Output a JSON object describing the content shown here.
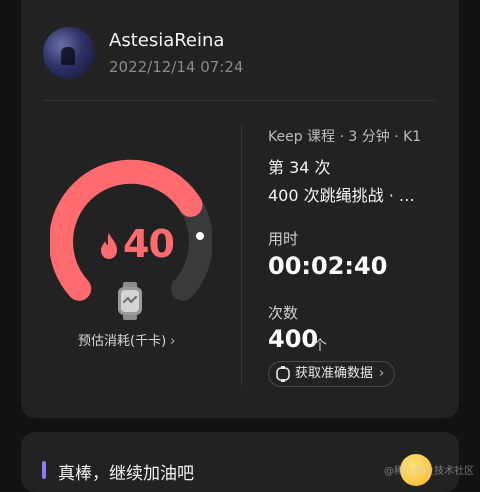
{
  "post": {
    "username": "AstesiaReina",
    "datetime": "2022/12/14 07:24"
  },
  "workout": {
    "calories": "40",
    "calories_label": "预估消耗(千卡)",
    "gauge_progress_fraction": 0.72,
    "course_line": "Keep 课程 · 3 分钟 · K1",
    "session_line": "第 34 次",
    "challenge_line": "400 次跳绳挑战 · …",
    "duration_label": "用时",
    "duration_value": "00:02:40",
    "count_label": "次数",
    "count_value": "400",
    "count_unit": "个",
    "accurate_data_button": "获取准确数据"
  },
  "feedback": {
    "text": "真棒，继续加油吧"
  },
  "watermark": "@稀土掘金技术社区",
  "icons": {
    "chevron": "›"
  },
  "colors": {
    "accent_red": "#ff6b6e",
    "accent_purple": "#8a7cf2"
  }
}
